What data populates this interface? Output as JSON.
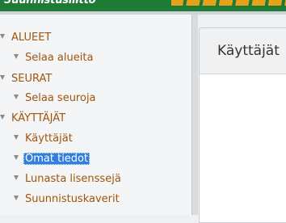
{
  "header": {
    "title": "Suunnistusliitto"
  },
  "sidebar": {
    "sections": [
      {
        "label": "ALUEET",
        "items": [
          {
            "label": "Selaa alueita"
          }
        ]
      },
      {
        "label": "SEURAT",
        "items": [
          {
            "label": "Selaa seuroja"
          }
        ]
      },
      {
        "label": "KÄYTTÄJÄT",
        "items": [
          {
            "label": "Käyttäjät"
          },
          {
            "label": "Omat tiedot",
            "active": true
          },
          {
            "label": "Lunasta lisenssejä"
          },
          {
            "label": "Suunnistuskaverit"
          }
        ]
      }
    ]
  },
  "main": {
    "title": "Käyttäjät"
  }
}
